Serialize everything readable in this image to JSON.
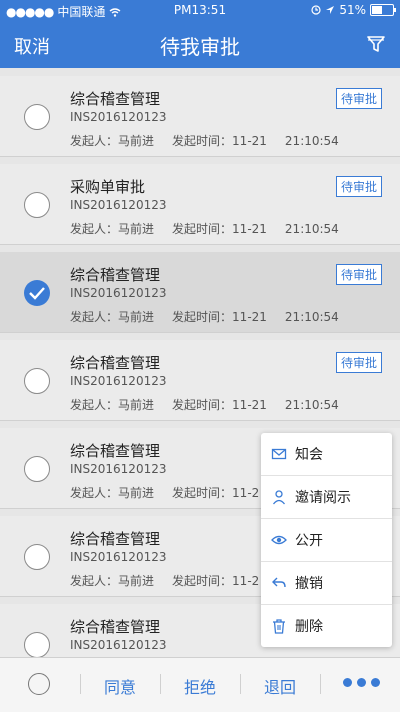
{
  "status": {
    "carrier": "中国联通",
    "time": "PM13:51",
    "battery": "51%"
  },
  "header": {
    "cancel_label": "取消",
    "title": "待我审批",
    "filter_icon": "filter-icon"
  },
  "items": [
    {
      "name": "综合稽查管理",
      "code": "INS2016120123",
      "initiator_label": "发起人：",
      "initiator": "马前进",
      "time_label": "发起时间：",
      "date": "11-21",
      "time": "21:10:54",
      "badge": "待审批",
      "checked": false
    },
    {
      "name": "采购单审批",
      "code": "INS2016120123",
      "initiator_label": "发起人：",
      "initiator": "马前进",
      "time_label": "发起时间：",
      "date": "11-21",
      "time": "21:10:54",
      "badge": "待审批",
      "checked": false
    },
    {
      "name": "综合稽查管理",
      "code": "INS2016120123",
      "initiator_label": "发起人：",
      "initiator": "马前进",
      "time_label": "发起时间：",
      "date": "11-21",
      "time": "21:10:54",
      "badge": "待审批",
      "checked": true
    },
    {
      "name": "综合稽查管理",
      "code": "INS2016120123",
      "initiator_label": "发起人：",
      "initiator": "马前进",
      "time_label": "发起时间：",
      "date": "11-21",
      "time": "21:10:54",
      "badge": "待审批",
      "checked": false
    },
    {
      "name": "综合稽查管理",
      "code": "INS2016120123",
      "initiator_label": "发起人：",
      "initiator": "马前进",
      "time_label": "发起时间：",
      "date": "11-2",
      "time": "",
      "badge": "",
      "checked": false
    },
    {
      "name": "综合稽查管理",
      "code": "INS2016120123",
      "initiator_label": "发起人：",
      "initiator": "马前进",
      "time_label": "发起时间：",
      "date": "11-2",
      "time": "",
      "badge": "",
      "checked": false
    },
    {
      "name": "综合稽查管理",
      "code": "INS2016120123",
      "initiator_label": "",
      "initiator": "",
      "time_label": "",
      "date": "",
      "time": "",
      "badge": "",
      "checked": false
    }
  ],
  "popup_menu": [
    {
      "label": "知会",
      "icon": "envelope-icon"
    },
    {
      "label": "邀请阅示",
      "icon": "person-icon"
    },
    {
      "label": "公开",
      "icon": "eye-icon"
    },
    {
      "label": "撤销",
      "icon": "undo-icon"
    },
    {
      "label": "删除",
      "icon": "trash-icon"
    }
  ],
  "bottom": {
    "agree": "同意",
    "reject": "拒绝",
    "return": "退回",
    "more_icon": "more-icon"
  },
  "colors": {
    "accent": "#3a7bd5"
  }
}
